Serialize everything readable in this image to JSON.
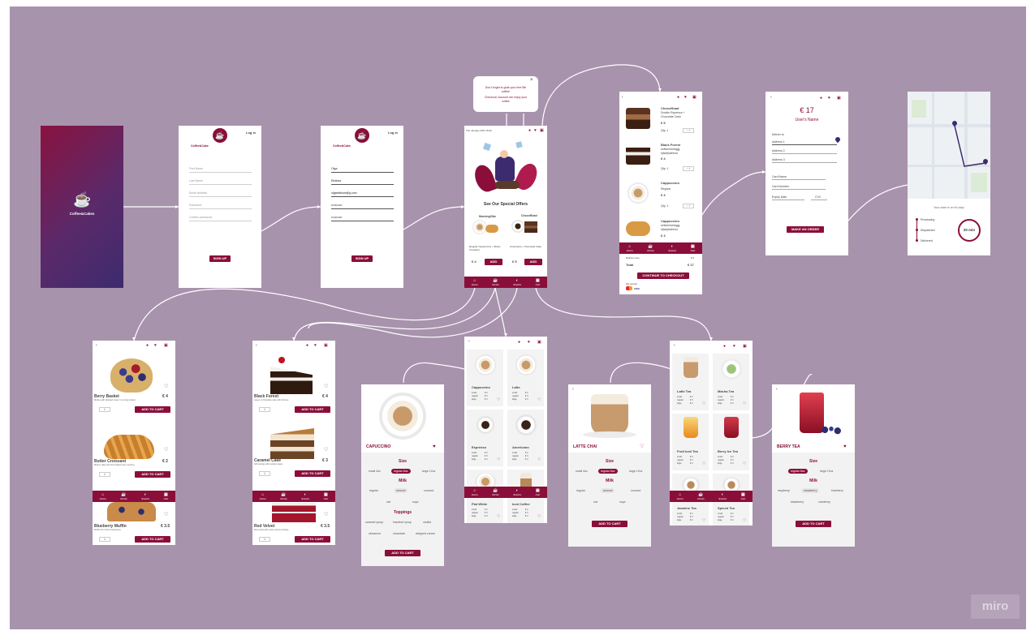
{
  "board": {
    "watermark": "miro",
    "bg_color": "#a893ad",
    "brand_color": "#8b0e3a"
  },
  "splash": {
    "brand": "Coffee&Cakes",
    "logo_icon": "coffee-cup-icon"
  },
  "signup": {
    "login_link": "Log in",
    "brand": "Coffee&Cake",
    "fields": [
      "First Name",
      "Last Name",
      "Email address",
      "Password",
      "Confirm password"
    ],
    "button": "SIGN UP"
  },
  "signup_filled": {
    "login_link": "Log in",
    "brand": "Coffee&Cake",
    "values": [
      "Olga",
      "Elstlova",
      "olgaelstlova@g.com",
      "•••••••••••",
      "•••••••••••"
    ],
    "button": "SIGN UP"
  },
  "tooltip": {
    "text1": "Don't forget to grab your free 5th coffee!",
    "text2": "Checkout: Account are enjoy your coffee",
    "close": "×"
  },
  "home": {
    "date": "Thu January 20th 15:00",
    "offers_title": "See Our Special Offers",
    "offers": [
      {
        "tag": "MorningVibe",
        "desc": "Regular Cappuccino + Butter Croissant",
        "price": "€ 4",
        "add": "ADD"
      },
      {
        "tag": "ChocoRoad",
        "desc": "Americano + Chocolate Cake",
        "price": "€ 5",
        "add": "ADD"
      }
    ]
  },
  "nav": {
    "items": [
      "Home",
      "Drinks",
      "Snacks",
      "Cart"
    ]
  },
  "cart": {
    "items": [
      {
        "name": "ChocoRoad",
        "detail": "Double Espresso + Chocolate Cake",
        "price": "€ 5",
        "qty": "Qty: 1"
      },
      {
        "name": "Black Forest",
        "detail": "sefwenhwhqgg hjfwejhwhhwr",
        "price": "€ 4",
        "qty": "Qty: 1"
      },
      {
        "name": "Cappuccino",
        "detail": "Regular",
        "price": "€ 3",
        "qty": "Qty: 1"
      },
      {
        "name": "Cappuccino",
        "detail": "sefwenhwhqgg hjfwejhwhhwr",
        "price": "€ 3",
        "qty": ""
      }
    ],
    "delivery_label": "Delivery Fee",
    "delivery_value": "€ 0",
    "total_label": "Total",
    "total_value": "€ 17",
    "checkout_button": "CONTINUE TO CHECKOUT",
    "we_accept": "We accept",
    "payments": [
      "MasterCard",
      "VISA"
    ]
  },
  "checkout": {
    "amount": "€ 17",
    "user_name": "User's Name",
    "deliver_to": "Deliver to",
    "fields": [
      "Address 1",
      "Address 2",
      "Address 3"
    ],
    "card_fields": [
      "Card Name",
      "Card Number"
    ],
    "expiry": "Expiry Date",
    "cvv": "CVV",
    "button": "MAKE AN ORDER"
  },
  "tracking": {
    "message": "Your order is on it's way!",
    "steps": [
      "Processing",
      "Dispatched",
      "Delivered"
    ],
    "eta": "20 min"
  },
  "cakes1": {
    "items": [
      {
        "name": "Berry Basket",
        "price": "€ 4",
        "desc": "Berries with whipped cream in a crispy basket",
        "qty": "1",
        "add": "ADD TO CART"
      },
      {
        "name": "Butter Croissant",
        "price": "€ 2",
        "desc": "Buttery, flaky and fresh baked every morning",
        "qty": "1",
        "add": "ADD TO CART"
      },
      {
        "name": "Blueberry Muffin",
        "price": "€ 3.5",
        "desc": "Muffin full of fresh blueberries",
        "qty": "1",
        "add": "ADD TO CART"
      }
    ]
  },
  "cakes2": {
    "items": [
      {
        "name": "Black Forest",
        "price": "€ 4",
        "desc": "Layers of chocolate cake with cherries",
        "qty": "1",
        "add": "ADD TO CART"
      },
      {
        "name": "Caramel Cake",
        "price": "€ 3",
        "desc": "Soft sponge with caramel layers",
        "qty": "1",
        "add": "ADD TO CART"
      },
      {
        "name": "Red Velvet",
        "price": "€ 3.5",
        "desc": "Red velvet with cream cheese frosting",
        "qty": "1",
        "add": "ADD TO CART"
      }
    ]
  },
  "coffee_list": {
    "items": [
      {
        "name": "Cappuccino",
        "sizes": [
          "small",
          "regular",
          "large"
        ],
        "prices": [
          "€ 2",
          "€ 3",
          "€ 4"
        ]
      },
      {
        "name": "Latte",
        "sizes": [
          "small",
          "regular",
          "large"
        ],
        "prices": [
          "€ 2",
          "€ 3",
          "€ 4"
        ]
      },
      {
        "name": "Espresso",
        "sizes": [
          "small",
          "regular",
          "large"
        ],
        "prices": [
          "€ 2",
          "€ 3",
          "€ 4"
        ]
      },
      {
        "name": "Americano",
        "sizes": [
          "small",
          "regular",
          "large"
        ],
        "prices": [
          "€ 2",
          "€ 3",
          "€ 4"
        ]
      },
      {
        "name": "Flat White",
        "sizes": [
          "small",
          "regular",
          "large"
        ],
        "prices": [
          "€ 2",
          "€ 3",
          "€ 4"
        ]
      },
      {
        "name": "Iced Coffee",
        "sizes": [
          "small",
          "regular",
          "large"
        ],
        "prices": [
          "€ 2",
          "€ 3",
          "€ 4"
        ]
      }
    ]
  },
  "tea_list": {
    "items": [
      {
        "name": "Latte Tea",
        "sizes": [
          "small",
          "regular",
          "large"
        ],
        "prices": [
          "€ 2",
          "€ 3",
          "€ 4"
        ]
      },
      {
        "name": "Macha Tea",
        "sizes": [
          "small",
          "regular",
          "large"
        ],
        "prices": [
          "€ 2",
          "€ 3",
          "€ 4"
        ]
      },
      {
        "name": "Fruit Iced Tea",
        "sizes": [
          "small",
          "regular",
          "large"
        ],
        "prices": [
          "€ 2",
          "€ 3",
          "€ 4"
        ]
      },
      {
        "name": "Berry Ice Tea",
        "sizes": [
          "small",
          "regular",
          "large"
        ],
        "prices": [
          "€ 2",
          "€ 3",
          "€ 4"
        ]
      },
      {
        "name": "Jasmine Tea",
        "sizes": [
          "small",
          "regular",
          "large"
        ],
        "prices": [
          "€ 2",
          "€ 3",
          "€ 4"
        ]
      },
      {
        "name": "Spiced Tea",
        "sizes": [
          "small",
          "regular",
          "large"
        ],
        "prices": [
          "€ 2",
          "€ 3",
          "€ 4"
        ]
      }
    ]
  },
  "cappuccino": {
    "title": "CAPUCCINO",
    "size_label": "Size",
    "sizes": [
      "small 4oz",
      "regular 8oz",
      "large 12oz"
    ],
    "milk_label": "Milk",
    "milks": [
      "regular",
      "almond",
      "coconut",
      "oat",
      "soya"
    ],
    "toppings_label": "Toppings",
    "toppings": [
      "caramel syrup",
      "hazelnut syrup",
      "vanilla",
      "cinnamon",
      "chocolate",
      "whipped cream"
    ],
    "add": "ADD TO CART"
  },
  "chai": {
    "title": "LATTE CHAI",
    "size_label": "Size",
    "sizes": [
      "small 4oz",
      "regular 8oz",
      "large 12oz"
    ],
    "milk_label": "Milk",
    "milks": [
      "regular",
      "almond",
      "coconut",
      "oat",
      "soya"
    ],
    "add": "ADD TO CART"
  },
  "berry": {
    "title": "BERRY TEA",
    "size_label": "Size",
    "sizes": [
      "regular 8oz",
      "large 12oz"
    ],
    "milk_label": "Milk",
    "milks": [
      "raspberry",
      "strawberry",
      "blueberry",
      "blackberry",
      "cranberry"
    ],
    "add": "ADD TO CART"
  }
}
